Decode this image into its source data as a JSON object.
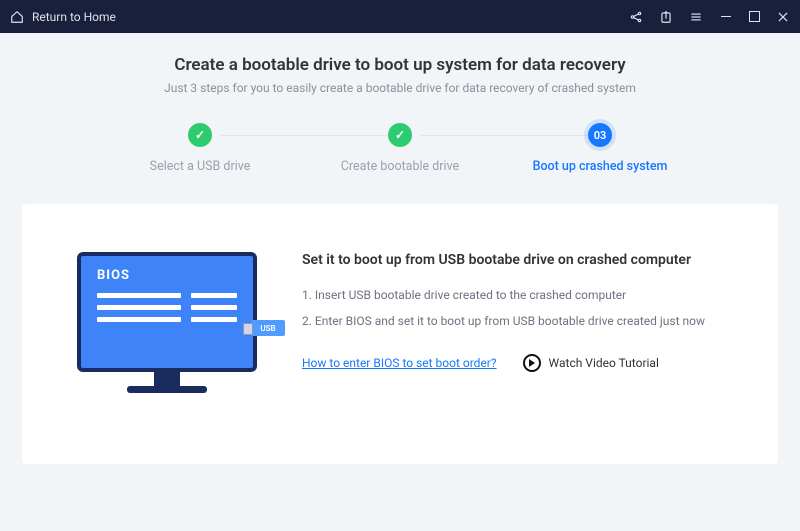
{
  "titlebar": {
    "home_label": "Return to Home"
  },
  "heading": {
    "title": "Create a bootable drive to boot up system for data recovery",
    "subtitle": "Just 3 steps for you to easily create a bootable drive for data recovery of crashed system"
  },
  "steps": {
    "s1": {
      "label": "Select a USB drive"
    },
    "s2": {
      "label": "Create bootable drive"
    },
    "s3": {
      "label": "Boot up crashed system",
      "badge": "03"
    }
  },
  "illustration": {
    "bios": "BIOS",
    "usb": "USB"
  },
  "content": {
    "title": "Set it to boot up from USB bootabe drive on crashed computer",
    "line1": "1. Insert USB bootable drive created to the crashed computer",
    "line2": "2. Enter BIOS and set it to boot up from USB bootable drive created just now",
    "bios_link": "How to enter BIOS to set boot order?",
    "watch_label": "Watch Video Tutorial"
  }
}
